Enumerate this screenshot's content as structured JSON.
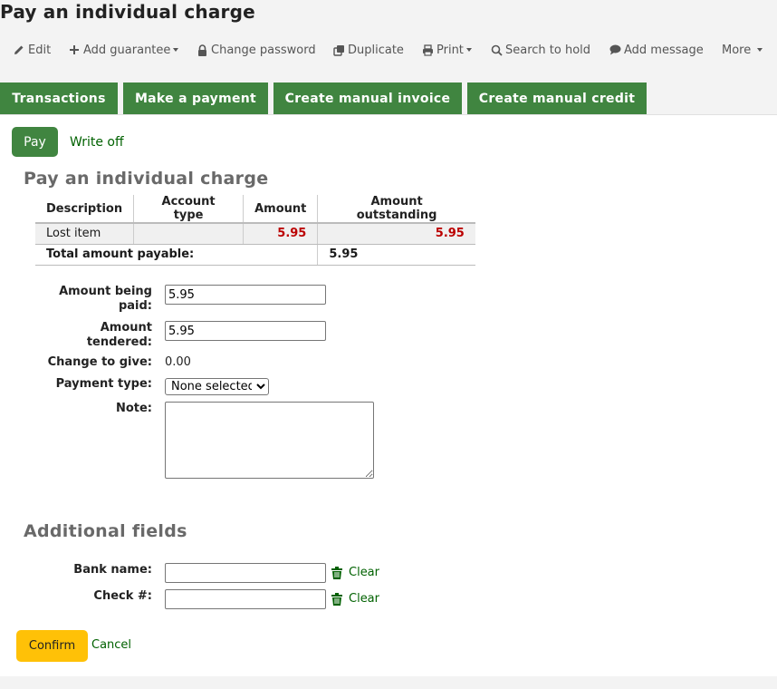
{
  "page": {
    "title": "Pay an individual charge"
  },
  "toolbar": {
    "edit": {
      "label": "Edit",
      "icon": "pencil-icon"
    },
    "add_guarantee": {
      "label": "Add guarantee",
      "icon": "plus-icon"
    },
    "change_password": {
      "label": "Change password",
      "icon": "lock-icon"
    },
    "duplicate": {
      "label": "Duplicate",
      "icon": "copy-icon"
    },
    "print": {
      "label": "Print",
      "icon": "printer-icon"
    },
    "search_to_hold": {
      "label": "Search to hold",
      "icon": "search-icon"
    },
    "add_message": {
      "label": "Add message",
      "icon": "comment-icon"
    },
    "more": {
      "label": "More"
    }
  },
  "tabs": [
    "Transactions",
    "Make a payment",
    "Create manual invoice",
    "Create manual credit"
  ],
  "subtabs": {
    "pay": "Pay",
    "write_off": "Write off"
  },
  "section_title": "Pay an individual charge",
  "charges_table": {
    "headers": [
      "Description",
      "Account type",
      "Amount",
      "Amount outstanding"
    ],
    "rows": [
      {
        "description": "Lost item",
        "account_type": "",
        "amount": "5.95",
        "outstanding": "5.95"
      }
    ],
    "total_label": "Total amount payable:",
    "total_value": "5.95"
  },
  "form": {
    "amount_paid_label": "Amount being paid:",
    "amount_paid_value": "5.95",
    "amount_tendered_label": "Amount tendered:",
    "amount_tendered_value": "5.95",
    "change_label": "Change to give:",
    "change_value": "0.00",
    "payment_type_label": "Payment type:",
    "payment_type_selected": "None selected",
    "note_label": "Note:"
  },
  "additional": {
    "title": "Additional fields",
    "bank_name_label": "Bank name:",
    "check_label": "Check #:",
    "clear_label": "Clear"
  },
  "actions": {
    "confirm": "Confirm",
    "cancel": "Cancel"
  },
  "colors": {
    "accent_green": "#408540",
    "link_green": "#006100",
    "confirm_yellow": "#ffc107",
    "amount_red": "#b00000"
  }
}
